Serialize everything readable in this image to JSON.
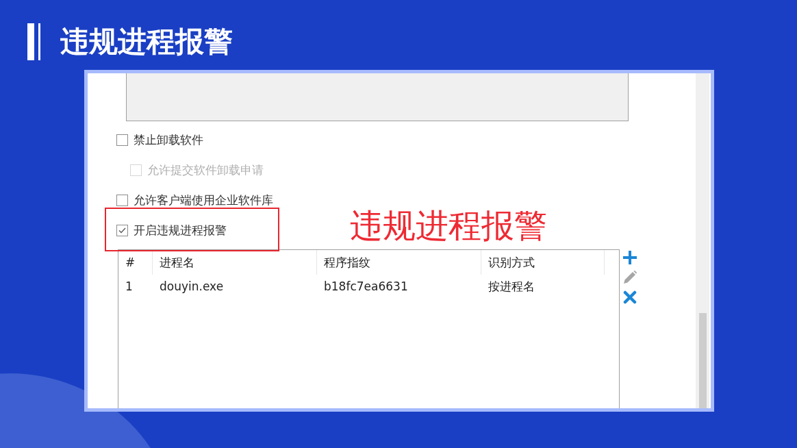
{
  "slide": {
    "title": "违规进程报警"
  },
  "screenshot": {
    "options": [
      {
        "label": "禁止卸载软件",
        "checked": false,
        "disabled": false,
        "highlighted": false,
        "children": [
          {
            "label": "允许提交软件卸载申请",
            "checked": false,
            "disabled": true,
            "highlighted": false
          }
        ]
      },
      {
        "label": "允许客户端使用企业软件库",
        "checked": false,
        "disabled": false,
        "highlighted": false
      },
      {
        "label": "开启违规进程报警",
        "checked": true,
        "disabled": false,
        "highlighted": true
      }
    ],
    "annotation": {
      "text": "违规进程报警"
    },
    "table": {
      "columns": [
        "#",
        "进程名",
        "程序指纹",
        "识别方式"
      ],
      "rows": [
        [
          "1",
          "douyin.exe",
          "b18fc7ea6631",
          "按进程名"
        ]
      ]
    },
    "actions": [
      {
        "kind": "add",
        "disabled": false
      },
      {
        "kind": "edit",
        "disabled": true
      },
      {
        "kind": "delete",
        "disabled": false
      }
    ]
  }
}
